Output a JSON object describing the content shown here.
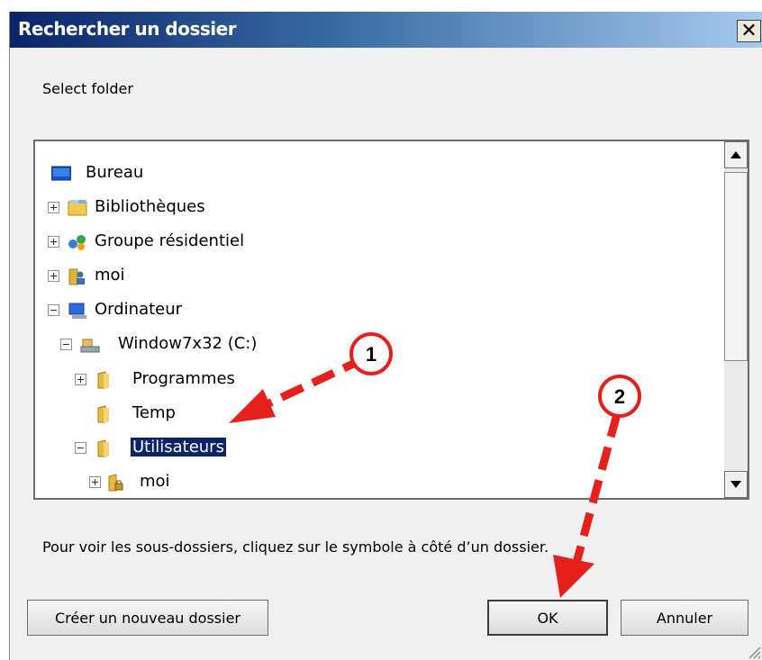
{
  "window": {
    "title": "Rechercher un dossier",
    "close_glyph": "✕"
  },
  "instruction": "Select folder",
  "tree": {
    "items": [
      {
        "label": "Bureau",
        "expander": "none",
        "icon": "desktop-icon"
      },
      {
        "label": "Bibliothèques",
        "expander": "plus",
        "icon": "libraries-icon"
      },
      {
        "label": "Groupe résidentiel",
        "expander": "plus",
        "icon": "homegroup-icon"
      },
      {
        "label": "moi",
        "expander": "plus",
        "icon": "user-folder-icon"
      },
      {
        "label": "Ordinateur",
        "expander": "minus",
        "icon": "computer-icon"
      },
      {
        "label": "Window7x32 (C:)",
        "expander": "minus",
        "icon": "drive-icon"
      },
      {
        "label": "Programmes",
        "expander": "plus",
        "icon": "folder-icon"
      },
      {
        "label": "Temp",
        "expander": "none",
        "icon": "folder-icon"
      },
      {
        "label": "Utilisateurs",
        "expander": "minus",
        "icon": "folder-icon",
        "selected": true
      },
      {
        "label": "moi",
        "expander": "plus",
        "icon": "locked-folder-icon"
      }
    ]
  },
  "hint": "Pour voir les sous-dossiers, cliquez sur le symbole à côté d’un dossier.",
  "buttons": {
    "new_folder": "Créer un nouveau dossier",
    "ok": "OK",
    "cancel": "Annuler"
  },
  "annotations": {
    "callout_1": "1",
    "callout_2": "2"
  },
  "colors": {
    "title_start": "#0a246a",
    "title_end": "#a6caf0",
    "selection": "#0a246a",
    "arrow": "#e8201c"
  }
}
